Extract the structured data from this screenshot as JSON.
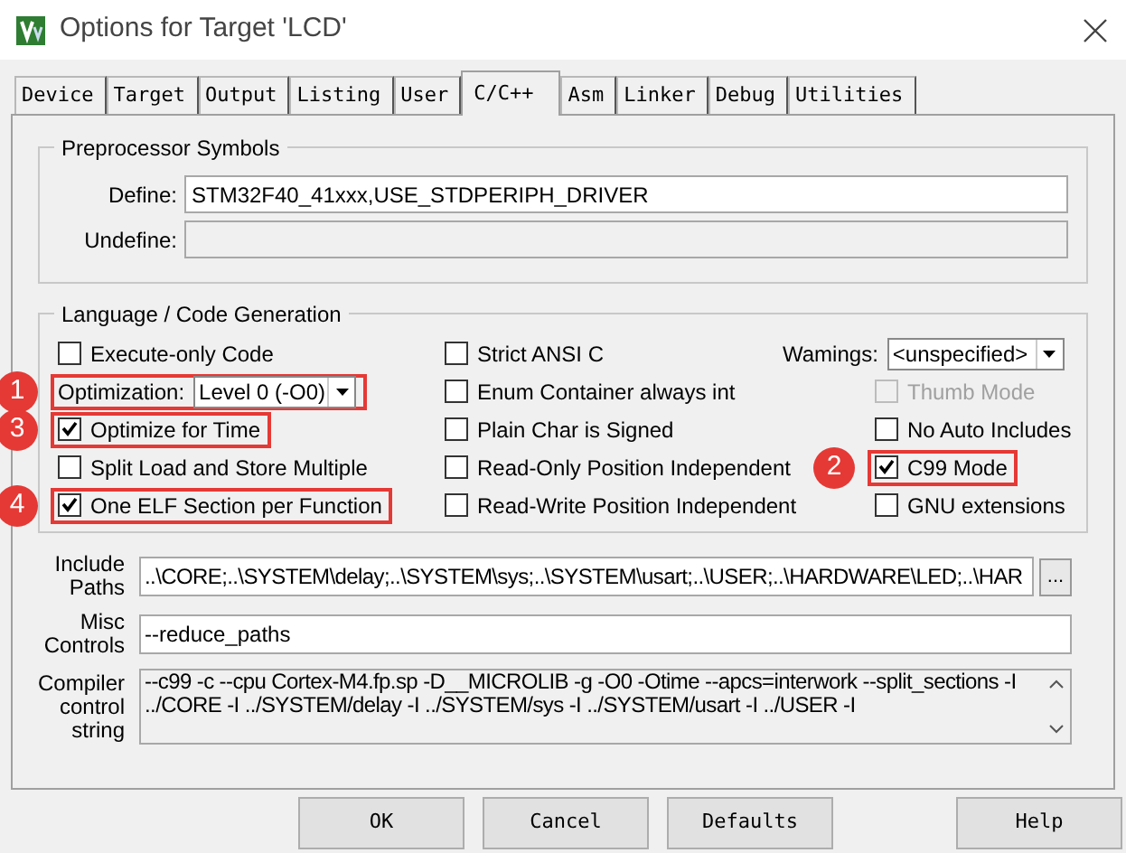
{
  "window": {
    "title": "Options for Target 'LCD'"
  },
  "tabs": [
    {
      "label": "Device",
      "selected": false
    },
    {
      "label": "Target",
      "selected": false
    },
    {
      "label": "Output",
      "selected": false
    },
    {
      "label": "Listing",
      "selected": false
    },
    {
      "label": "User",
      "selected": false
    },
    {
      "label": "C/C++",
      "selected": true
    },
    {
      "label": "Asm",
      "selected": false
    },
    {
      "label": "Linker",
      "selected": false
    },
    {
      "label": "Debug",
      "selected": false
    },
    {
      "label": "Utilities",
      "selected": false
    }
  ],
  "preprocessor": {
    "title": "Preprocessor Symbols",
    "define": {
      "label": "Define:",
      "value": "STM32F40_41xxx,USE_STDPERIPH_DRIVER"
    },
    "undefine": {
      "label": "Undefine:",
      "disabled": true
    }
  },
  "language": {
    "title": "Language / Code Generation",
    "columns": [
      [
        {
          "kind": "checkbox",
          "label": "Execute-only Code",
          "checked": false,
          "disabled": false
        },
        {
          "kind": "select",
          "label": "Optimization:",
          "value": "Level 0 (-O0)",
          "callout": "1"
        },
        {
          "kind": "checkbox",
          "label": "Optimize for Time",
          "checked": true,
          "disabled": false,
          "callout": "3"
        },
        {
          "kind": "checkbox",
          "label": "Split Load and Store Multiple",
          "checked": false,
          "disabled": false
        },
        {
          "kind": "checkbox",
          "label": "One ELF Section per Function",
          "checked": true,
          "disabled": false,
          "callout": "4"
        }
      ],
      [
        {
          "kind": "checkbox",
          "label": "Strict ANSI C",
          "checked": false,
          "disabled": false
        },
        {
          "kind": "checkbox",
          "label": "Enum Container always int",
          "checked": false,
          "disabled": false
        },
        {
          "kind": "checkbox",
          "label": "Plain Char is Signed",
          "checked": false,
          "disabled": false
        },
        {
          "kind": "checkbox",
          "label": "Read-Only Position Independent",
          "checked": false,
          "disabled": false
        },
        {
          "kind": "checkbox",
          "label": "Read-Write Position Independent",
          "checked": false,
          "disabled": false
        }
      ],
      [
        {
          "kind": "select",
          "label": "Wamings:",
          "value": "<unspecified>"
        },
        {
          "kind": "checkbox",
          "label": "Thumb Mode",
          "checked": false,
          "disabled": true
        },
        {
          "kind": "checkbox",
          "label": "No Auto Includes",
          "checked": false,
          "disabled": false
        },
        {
          "kind": "checkbox",
          "label": "C99 Mode",
          "checked": true,
          "disabled": false,
          "callout": "2"
        },
        {
          "kind": "checkbox",
          "label": "GNU extensions",
          "checked": false,
          "disabled": false
        }
      ]
    ]
  },
  "include_paths": {
    "label_lines": [
      "Include",
      "Paths"
    ],
    "value": "..\\CORE;..\\SYSTEM\\delay;..\\SYSTEM\\sys;..\\SYSTEM\\usart;..\\USER;..\\HARDWARE\\LED;..\\HAR",
    "browse": "..."
  },
  "misc_controls": {
    "label_lines": [
      "Misc",
      "Controls"
    ],
    "value": "--reduce_paths"
  },
  "compiler_string": {
    "label_lines": [
      "Compiler",
      "control",
      "string"
    ],
    "lines": [
      "--c99 -c --cpu Cortex-M4.fp.sp -D__MICROLIB -g -O0 -Otime --apcs=interwork --split_sections -I",
      "../CORE -I ../SYSTEM/delay -I ../SYSTEM/sys -I ../SYSTEM/usart -I ../USER -I"
    ]
  },
  "buttons": [
    "OK",
    "Cancel",
    "Defaults",
    "Help"
  ]
}
